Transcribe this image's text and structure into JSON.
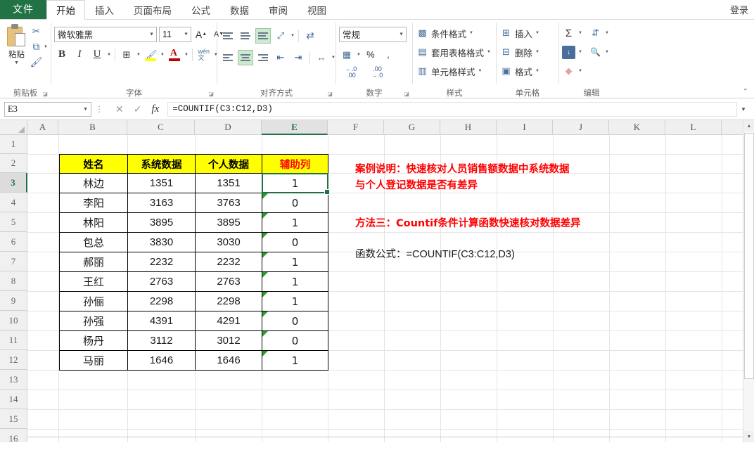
{
  "titlebar": {
    "signin": "登录"
  },
  "tabs": [
    {
      "label": "文件",
      "id": "file",
      "active": false
    },
    {
      "label": "开始",
      "id": "home",
      "active": true
    },
    {
      "label": "插入",
      "id": "insert",
      "active": false
    },
    {
      "label": "页面布局",
      "id": "pagelayout",
      "active": false
    },
    {
      "label": "公式",
      "id": "formulas",
      "active": false
    },
    {
      "label": "数据",
      "id": "data",
      "active": false
    },
    {
      "label": "审阅",
      "id": "review",
      "active": false
    },
    {
      "label": "视图",
      "id": "view",
      "active": false
    }
  ],
  "ribbon": {
    "clipboard": {
      "group_label": "剪贴板",
      "paste_label": "粘贴",
      "cut_icon": "scissors-icon",
      "copy_icon": "copy-icon",
      "format_painter_icon": "format-painter-icon"
    },
    "font": {
      "group_label": "字体",
      "font_name": "微软雅黑",
      "font_size": "11",
      "grow_font": "A",
      "shrink_font": "A",
      "bold": "B",
      "italic": "I",
      "underline": "U",
      "borders_icon": "borders-icon",
      "fill_color_icon": "fill-color-icon",
      "font_color_icon": "font-color-icon",
      "phonetic_label": "拼音"
    },
    "alignment": {
      "group_label": "对齐方式",
      "orientation_icon": "orientation-icon",
      "wrap_text_icon": "wrap-text-icon",
      "merge_icon": "merge-center-icon",
      "indent_decrease_icon": "decrease-indent-icon",
      "indent_increase_icon": "increase-indent-icon"
    },
    "number": {
      "group_label": "数字",
      "format": "常规",
      "accounting_icon": "accounting-format-icon",
      "percent": "%",
      "comma": ",",
      "inc_dec_label": ".00",
      "dec_dec_label": ".0"
    },
    "styles": {
      "group_label": "样式",
      "items": [
        {
          "label": "条件格式",
          "icon": "conditional-formatting-icon"
        },
        {
          "label": "套用表格格式",
          "icon": "format-as-table-icon"
        },
        {
          "label": "单元格样式",
          "icon": "cell-styles-icon"
        }
      ]
    },
    "cells": {
      "group_label": "单元格",
      "items": [
        {
          "label": "插入",
          "icon": "insert-cells-icon"
        },
        {
          "label": "删除",
          "icon": "delete-cells-icon"
        },
        {
          "label": "格式",
          "icon": "format-cells-icon"
        }
      ]
    },
    "editing": {
      "group_label": "编辑",
      "autosum_icon": "sigma-icon",
      "fill_icon": "fill-down-icon",
      "clear_icon": "eraser-icon",
      "sort_filter_icon": "sort-filter-icon",
      "find_select_icon": "binoculars-icon"
    },
    "collapse_icon": "chevron-up-icon"
  },
  "formula_bar": {
    "name_box": "E3",
    "cancel_icon": "cancel-icon",
    "enter_icon": "check-icon",
    "function_icon": "fx-icon",
    "formula": "=COUNTIF(C3:C12,D3)",
    "expand_icon": "chevron-down-icon"
  },
  "grid": {
    "columns": [
      "A",
      "B",
      "C",
      "D",
      "E",
      "F",
      "G",
      "H",
      "I",
      "J",
      "K",
      "L"
    ],
    "selected_column": "E",
    "rows": [
      1,
      2,
      3,
      4,
      5,
      6,
      7,
      8,
      9,
      10,
      11,
      12,
      13,
      14,
      15,
      16
    ],
    "selected_row": 3,
    "selected_cell": "E3"
  },
  "table": {
    "headers": [
      "姓名",
      "系统数据",
      "个人数据",
      "辅助列"
    ],
    "header_fill": "#ffff00",
    "header_red_color": "#ff0000",
    "rows": [
      {
        "row": 3,
        "name": "林边",
        "system": "1351",
        "personal": "1351",
        "aux": "1",
        "flag": false
      },
      {
        "row": 4,
        "name": "李阳",
        "system": "3163",
        "personal": "3763",
        "aux": "0",
        "flag": true
      },
      {
        "row": 5,
        "name": "林阳",
        "system": "3895",
        "personal": "3895",
        "aux": "1",
        "flag": true
      },
      {
        "row": 6,
        "name": "包总",
        "system": "3830",
        "personal": "3030",
        "aux": "0",
        "flag": true
      },
      {
        "row": 7,
        "name": "郝丽",
        "system": "2232",
        "personal": "2232",
        "aux": "1",
        "flag": true
      },
      {
        "row": 8,
        "name": "王红",
        "system": "2763",
        "personal": "2763",
        "aux": "1",
        "flag": true
      },
      {
        "row": 9,
        "name": "孙俪",
        "system": "2298",
        "personal": "2298",
        "aux": "1",
        "flag": true
      },
      {
        "row": 10,
        "name": "孙强",
        "system": "4391",
        "personal": "4291",
        "aux": "0",
        "flag": true
      },
      {
        "row": 11,
        "name": "杨丹",
        "system": "3112",
        "personal": "3012",
        "aux": "0",
        "flag": true
      },
      {
        "row": 12,
        "name": "马丽",
        "system": "1646",
        "personal": "1646",
        "aux": "1",
        "flag": true
      }
    ]
  },
  "notes": {
    "case_line1": "案例说明：快速核对人员销售额数据中系统数据",
    "case_line2": "与个人登记数据是否有差异",
    "method_line": "方法三：Countif条件计算函数快速核对数据差异",
    "formula_note": "函数公式：=COUNTIF(C3:C12,D3)"
  }
}
